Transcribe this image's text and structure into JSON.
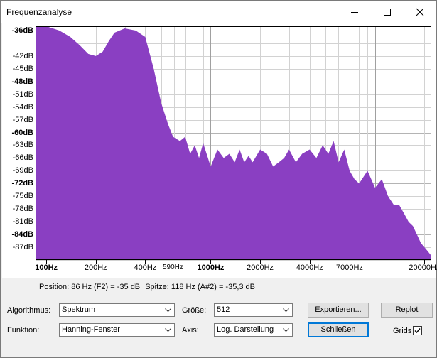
{
  "window": {
    "title": "Frequenzanalyse",
    "minimize_icon": "minimize-icon",
    "maximize_icon": "maximize-icon",
    "close_icon": "close-icon"
  },
  "plot": {
    "fill_color": "#8a3fc2",
    "y_ticks": [
      {
        "label": "-36dB",
        "db": -36,
        "bold": true
      },
      {
        "label": "-42dB",
        "db": -42,
        "bold": false
      },
      {
        "label": "-45dB",
        "db": -45,
        "bold": false
      },
      {
        "label": "-48dB",
        "db": -48,
        "bold": true
      },
      {
        "label": "-51dB",
        "db": -51,
        "bold": false
      },
      {
        "label": "-54dB",
        "db": -54,
        "bold": false
      },
      {
        "label": "-57dB",
        "db": -57,
        "bold": false
      },
      {
        "label": "-60dB",
        "db": -60,
        "bold": true
      },
      {
        "label": "-63dB",
        "db": -63,
        "bold": false
      },
      {
        "label": "-66dB",
        "db": -66,
        "bold": false
      },
      {
        "label": "-69dB",
        "db": -69,
        "bold": false
      },
      {
        "label": "-72dB",
        "db": -72,
        "bold": true
      },
      {
        "label": "-75dB",
        "db": -75,
        "bold": false
      },
      {
        "label": "-78dB",
        "db": -78,
        "bold": false
      },
      {
        "label": "-81dB",
        "db": -81,
        "bold": false
      },
      {
        "label": "-84dB",
        "db": -84,
        "bold": true
      },
      {
        "label": "-87dB",
        "db": -87,
        "bold": false
      }
    ],
    "x_ticks": [
      {
        "label": "100Hz",
        "hz": 100,
        "bold": true,
        "small": false
      },
      {
        "label": "200Hz",
        "hz": 200,
        "bold": false,
        "small": false
      },
      {
        "label": "400Hz",
        "hz": 400,
        "bold": false,
        "small": false
      },
      {
        "label": "590Hz",
        "hz": 590,
        "bold": false,
        "small": true
      },
      {
        "label": "1000Hz",
        "hz": 1000,
        "bold": true,
        "small": false
      },
      {
        "label": "2000Hz",
        "hz": 2000,
        "bold": false,
        "small": false
      },
      {
        "label": "4000Hz",
        "hz": 4000,
        "bold": false,
        "small": false
      },
      {
        "label": "7000Hz",
        "hz": 7000,
        "bold": false,
        "small": false
      },
      {
        "label": "20000Hz",
        "hz": 20000,
        "bold": false,
        "small": false
      }
    ]
  },
  "chart_data": {
    "type": "area",
    "title": "",
    "xlabel": "",
    "ylabel": "",
    "x_scale": "log",
    "xlim": [
      86,
      22000
    ],
    "ylim": [
      -90,
      -35
    ],
    "grid": true,
    "series": [
      {
        "x": [
          86,
          100,
          120,
          140,
          160,
          180,
          200,
          220,
          240,
          260,
          300,
          350,
          400,
          450,
          500,
          550,
          590,
          650,
          700,
          750,
          800,
          850,
          900,
          1000,
          1100,
          1200,
          1300,
          1400,
          1500,
          1600,
          1700,
          1800,
          2000,
          2200,
          2400,
          2600,
          2800,
          3000,
          3300,
          3600,
          4000,
          4400,
          4800,
          5200,
          5600,
          6000,
          6500,
          7000,
          7500,
          8000,
          9000,
          10000,
          11000,
          12000,
          13000,
          14000,
          15000,
          16000,
          17000,
          18000,
          19000,
          20000,
          21000,
          22000
        ],
        "y": [
          -35,
          -35,
          -36,
          -37.5,
          -39.5,
          -41.5,
          -42,
          -41,
          -38.5,
          -36.5,
          -35.5,
          -36,
          -37.5,
          -45,
          -53,
          -58,
          -61,
          -62,
          -61,
          -65,
          -63,
          -66,
          -62.5,
          -68,
          -64,
          -66,
          -65,
          -67,
          -64,
          -67,
          -65.5,
          -67,
          -64,
          -65,
          -68,
          -67,
          -66,
          -64,
          -67,
          -65,
          -64,
          -66,
          -63,
          -65,
          -62,
          -67,
          -64,
          -69,
          -71,
          -72,
          -69,
          -73,
          -71,
          -75,
          -77,
          -77,
          -79,
          -81,
          -82,
          -84,
          -86,
          -87,
          -88,
          -89
        ]
      }
    ]
  },
  "status": {
    "position": "Position: 86 Hz (F2) = -35 dB",
    "peak": "Spitze: 118 Hz (A#2) = -35,3 dB"
  },
  "controls": {
    "algorithm_label": "Algorithmus:",
    "algorithm_value": "Spektrum",
    "function_label": "Funktion:",
    "function_value": "Hanning-Fenster",
    "size_label": "Größe:",
    "size_value": "512",
    "axis_label": "Axis:",
    "axis_value": "Log. Darstellung",
    "export_label": "Exportieren...",
    "close_label": "Schließen",
    "replot_label": "Replot",
    "grids_label": "Grids",
    "grids_checked": true
  }
}
